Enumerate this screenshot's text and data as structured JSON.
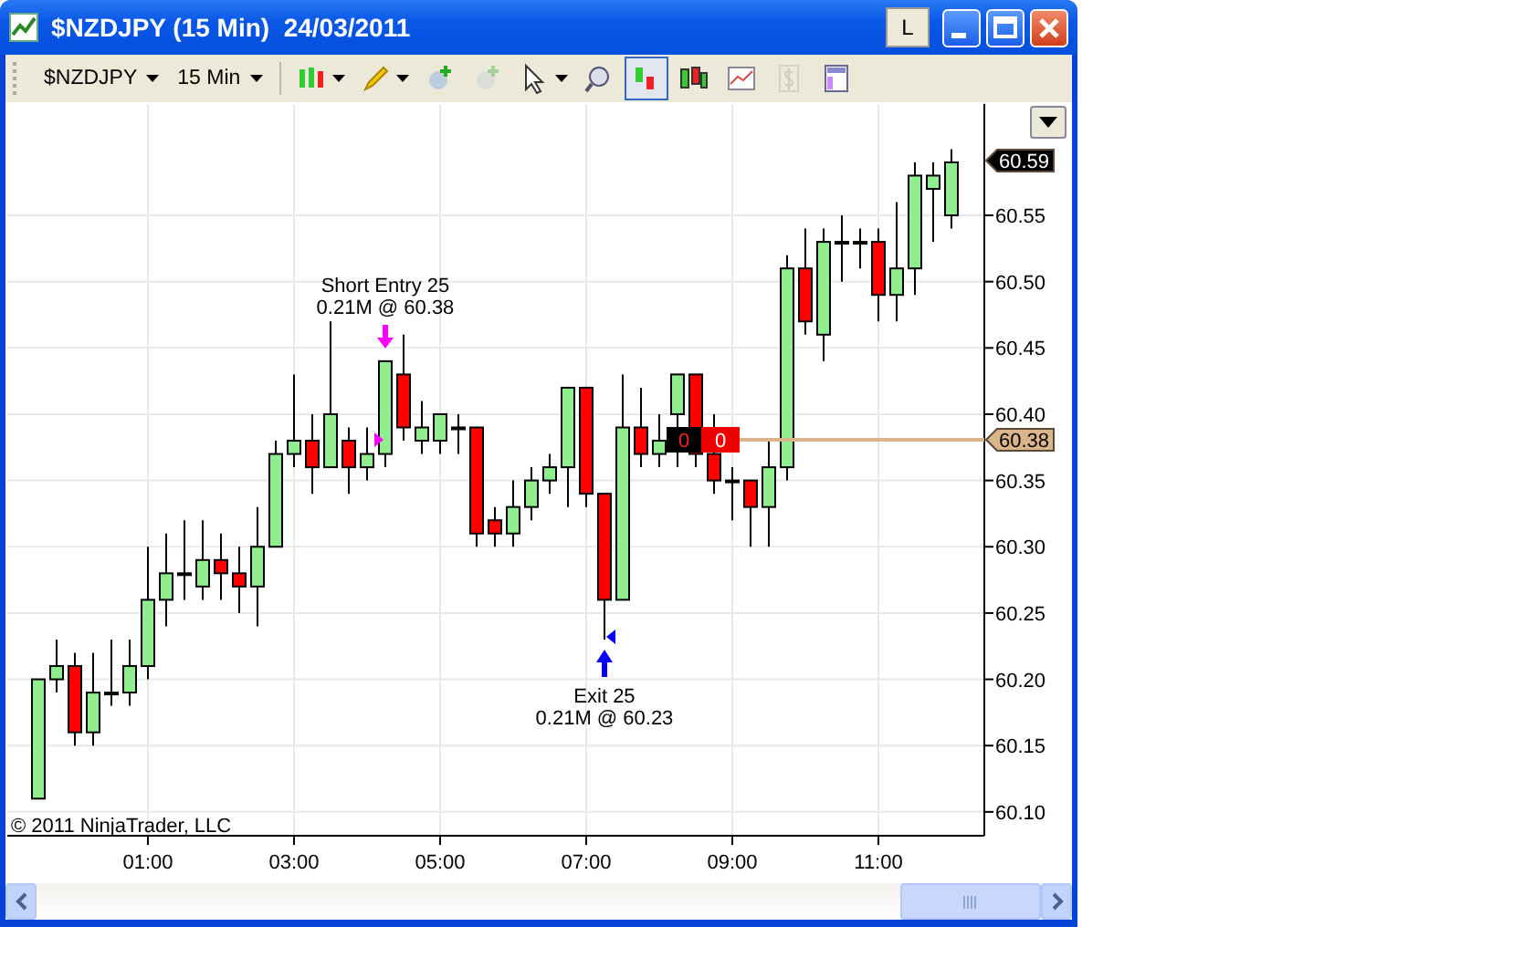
{
  "window": {
    "title": "$NZDJPY (15 Min)  24/03/2011",
    "link_button": "L"
  },
  "toolbar": {
    "instrument": "$NZDJPY",
    "interval": "15 Min",
    "tools": [
      {
        "kind": "bar-style",
        "dropdown": true,
        "selected": false,
        "disabled": false
      },
      {
        "kind": "draw",
        "dropdown": true,
        "selected": false,
        "disabled": false
      },
      {
        "kind": "add-strategy",
        "dropdown": false,
        "selected": false,
        "disabled": false
      },
      {
        "kind": "remove-strategy",
        "dropdown": false,
        "selected": false,
        "disabled": true
      },
      {
        "kind": "pointer",
        "dropdown": true,
        "selected": false,
        "disabled": false
      },
      {
        "kind": "zoom",
        "dropdown": false,
        "selected": false,
        "disabled": false
      },
      {
        "kind": "trades",
        "dropdown": false,
        "selected": true,
        "disabled": false
      },
      {
        "kind": "bars",
        "dropdown": false,
        "selected": false,
        "disabled": false
      },
      {
        "kind": "indicators",
        "dropdown": false,
        "selected": false,
        "disabled": false
      },
      {
        "kind": "currency",
        "dropdown": false,
        "selected": false,
        "disabled": true
      },
      {
        "kind": "properties",
        "dropdown": false,
        "selected": false,
        "disabled": false
      }
    ]
  },
  "chart": {
    "copyright": "© 2011 NinjaTrader, LLC",
    "chart_data": {
      "type": "candlestick",
      "categories": [
        null,
        null,
        null,
        null,
        null,
        null,
        "01:00",
        null,
        null,
        null,
        null,
        null,
        null,
        null,
        "03:00",
        null,
        null,
        null,
        null,
        null,
        null,
        null,
        "05:00",
        null,
        null,
        null,
        null,
        null,
        null,
        null,
        "07:00",
        null,
        null,
        null,
        null,
        null,
        null,
        null,
        "09:00",
        null,
        null,
        null,
        null,
        null,
        null,
        null,
        "11:00",
        null,
        null,
        null,
        null
      ],
      "ohlc": [
        [
          60.11,
          60.2,
          60.11,
          60.2
        ],
        [
          60.2,
          60.23,
          60.19,
          60.21
        ],
        [
          60.21,
          60.22,
          60.15,
          60.16
        ],
        [
          60.16,
          60.22,
          60.15,
          60.19
        ],
        [
          60.19,
          60.23,
          60.18,
          60.19
        ],
        [
          60.19,
          60.23,
          60.18,
          60.21
        ],
        [
          60.21,
          60.3,
          60.2,
          60.26
        ],
        [
          60.26,
          60.31,
          60.24,
          60.28
        ],
        [
          60.28,
          60.32,
          60.26,
          60.28
        ],
        [
          60.27,
          60.32,
          60.26,
          60.29
        ],
        [
          60.29,
          60.31,
          60.26,
          60.28
        ],
        [
          60.28,
          60.3,
          60.25,
          60.27
        ],
        [
          60.27,
          60.33,
          60.24,
          60.3
        ],
        [
          60.3,
          60.38,
          60.3,
          60.37
        ],
        [
          60.37,
          60.43,
          60.36,
          60.38
        ],
        [
          60.38,
          60.4,
          60.34,
          60.36
        ],
        [
          60.36,
          60.47,
          60.36,
          60.4
        ],
        [
          60.38,
          60.39,
          60.34,
          60.36
        ],
        [
          60.36,
          60.39,
          60.35,
          60.37
        ],
        [
          60.37,
          60.44,
          60.36,
          60.44
        ],
        [
          60.43,
          60.46,
          60.38,
          60.39
        ],
        [
          60.38,
          60.41,
          60.37,
          60.39
        ],
        [
          60.38,
          60.4,
          60.37,
          60.4
        ],
        [
          60.39,
          60.4,
          60.37,
          60.39
        ],
        [
          60.39,
          60.39,
          60.3,
          60.31
        ],
        [
          60.32,
          60.33,
          60.3,
          60.31
        ],
        [
          60.31,
          60.35,
          60.3,
          60.33
        ],
        [
          60.33,
          60.36,
          60.32,
          60.35
        ],
        [
          60.35,
          60.37,
          60.34,
          60.36
        ],
        [
          60.36,
          60.42,
          60.33,
          60.42
        ],
        [
          60.42,
          60.42,
          60.33,
          60.34
        ],
        [
          60.34,
          60.34,
          60.23,
          60.26
        ],
        [
          60.26,
          60.43,
          60.26,
          60.39
        ],
        [
          60.39,
          60.42,
          60.36,
          60.37
        ],
        [
          60.37,
          60.4,
          60.36,
          60.38
        ],
        [
          60.4,
          60.43,
          60.36,
          60.43
        ],
        [
          60.43,
          60.43,
          60.36,
          60.37
        ],
        [
          60.37,
          60.4,
          60.34,
          60.35
        ],
        [
          60.35,
          60.36,
          60.32,
          60.35
        ],
        [
          60.35,
          60.35,
          60.3,
          60.33
        ],
        [
          60.33,
          60.38,
          60.3,
          60.36
        ],
        [
          60.36,
          60.52,
          60.35,
          60.51
        ],
        [
          60.51,
          60.54,
          60.46,
          60.47
        ],
        [
          60.46,
          60.54,
          60.44,
          60.53
        ],
        [
          60.53,
          60.55,
          60.5,
          60.53
        ],
        [
          60.53,
          60.54,
          60.51,
          60.53
        ],
        [
          60.53,
          60.54,
          60.47,
          60.49
        ],
        [
          60.49,
          60.56,
          60.47,
          60.51
        ],
        [
          60.51,
          60.59,
          60.49,
          60.58
        ],
        [
          60.57,
          60.59,
          60.53,
          60.58
        ],
        [
          60.55,
          60.6,
          60.54,
          60.59
        ]
      ],
      "ylim": [
        60.082,
        60.634
      ],
      "grid": true,
      "yticks": [
        {
          "value": 60.1,
          "label": "60.10"
        },
        {
          "value": 60.15,
          "label": "60.15"
        },
        {
          "value": 60.2,
          "label": "60.20"
        },
        {
          "value": 60.25,
          "label": "60.25"
        },
        {
          "value": 60.3,
          "label": "60.30"
        },
        {
          "value": 60.35,
          "label": "60.35"
        },
        {
          "value": 60.4,
          "label": "60.40"
        },
        {
          "value": 60.45,
          "label": "60.45"
        },
        {
          "value": 60.5,
          "label": "60.50"
        },
        {
          "value": 60.55,
          "label": "60.55"
        }
      ]
    },
    "trades": [
      {
        "kind": "entry",
        "label": "Short Entry 25",
        "detail": "0.21M @ 60.38"
      },
      {
        "kind": "exit",
        "label": "Exit 25",
        "detail": "0.21M @ 60.23"
      }
    ],
    "position": {
      "quantity": "0",
      "pnl": "0"
    },
    "price_tags": [
      {
        "kind": "last",
        "text": "60.59"
      },
      {
        "kind": "position",
        "text": "60.38"
      }
    ]
  }
}
